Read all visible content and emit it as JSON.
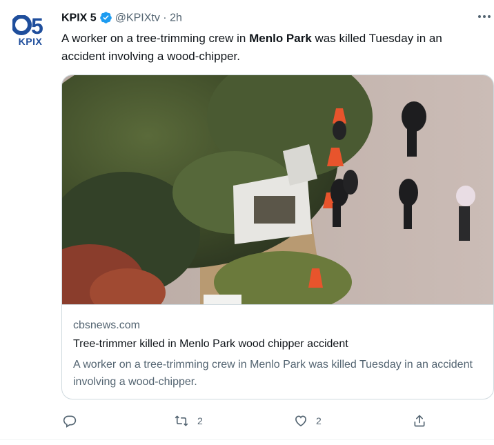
{
  "account": {
    "name": "KPIX 5",
    "handle": "@KPIXtv",
    "separator": "·",
    "time": "2h",
    "logo_text": "KPIX",
    "logo_number": "5",
    "verified": true
  },
  "tweet": {
    "text_part1": "A worker on a tree-trimming crew in ",
    "text_bold": "Menlo Park",
    "text_part2": " was killed Tuesday in an accident involving a wood-chipper."
  },
  "card": {
    "domain": "cbsnews.com",
    "title": "Tree-trimmer killed in Menlo Park wood chipper accident",
    "description": "A worker on a tree-trimming crew in Menlo Park was killed Tuesday in an accident involving a wood-chipper."
  },
  "actions": {
    "reply_count": "",
    "retweet_count": "2",
    "like_count": "2"
  },
  "icons": {
    "more": "more-icon",
    "reply": "reply-icon",
    "retweet": "retweet-icon",
    "like": "heart-icon",
    "share": "share-icon"
  },
  "colors": {
    "brand_blue": "#1f4e9c",
    "verified_blue": "#1d9bf0",
    "text": "#0f1419",
    "secondary": "#536471",
    "border": "#cfd9de"
  }
}
